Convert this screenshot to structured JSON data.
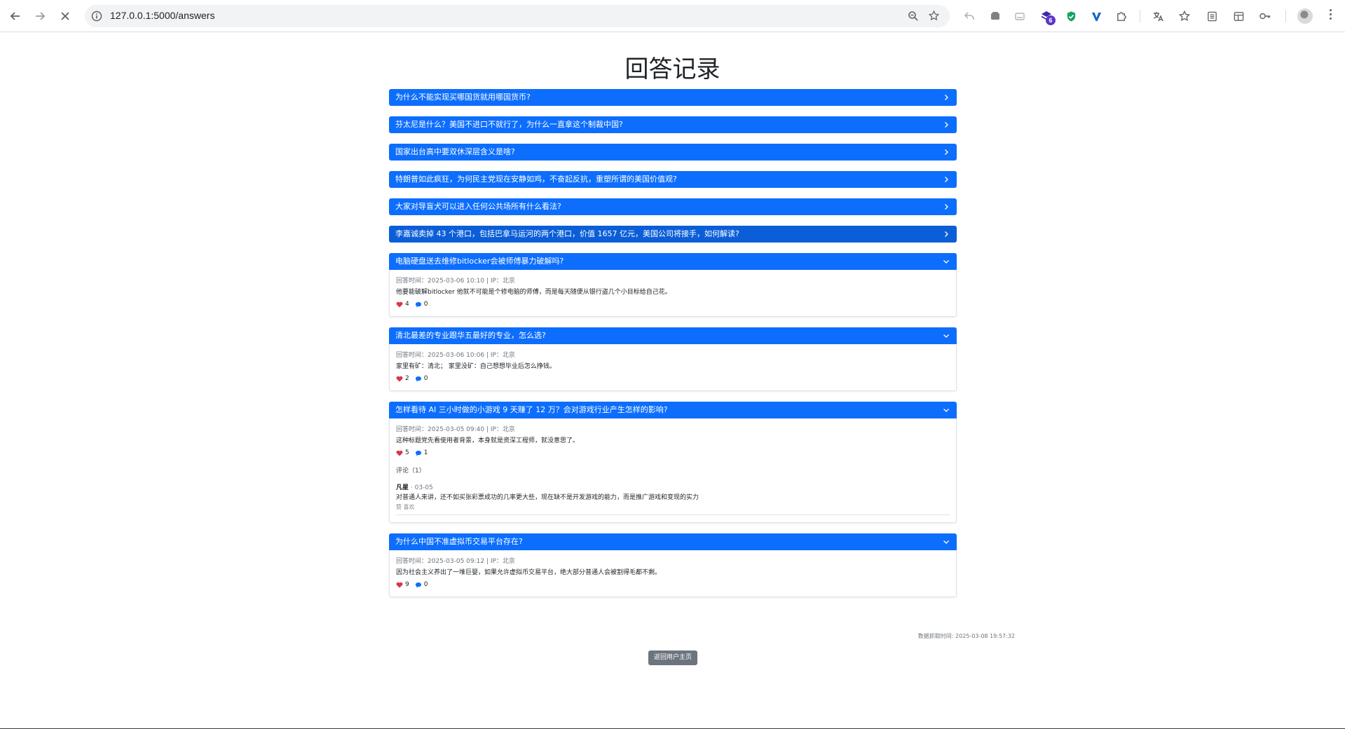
{
  "browser": {
    "url": "127.0.0.1:5000/answers",
    "extension_badge": "6"
  },
  "page": {
    "title": "回答记录",
    "fetch_time": "数据抓取时间: 2025-03-08 19:57:32",
    "back_button": "返回用户主页"
  },
  "questions": [
    {
      "title": "为什么不能实现买哪国货就用哪国货币?"
    },
    {
      "title": "芬太尼是什么？美国不进口不就行了，为什么一直拿这个制裁中国?"
    },
    {
      "title": "国家出台高中要双休深层含义是啥?"
    },
    {
      "title": "特朗普如此疯狂，为何民主党现在安静如鸡，不奋起反抗，重塑所谓的美国价值观?"
    },
    {
      "title": "大家对导盲犬可以进入任何公共场所有什么看法?"
    },
    {
      "title": "李嘉诚卖掉 43 个港口，包括巴拿马运河的两个港口，价值 1657 亿元，美国公司将接手，如何解读?"
    }
  ],
  "answers": [
    {
      "title": "电脑硬盘送去维修bitlocker会被师傅暴力破解吗?",
      "meta": "回答时间：2025-03-06 10:10 | IP：北京",
      "text": "他要能破解bitlocker 他就不可能是个修电脑的师傅，而是每天随便从银行盗几个小目标给自己花。",
      "likes": "4",
      "comments": "0"
    },
    {
      "title": "清北最差的专业跟华五最好的专业，怎么选?",
      "meta": "回答时间：2025-03-06 10:06 | IP：北京",
      "text": "家里有矿：清北； 家里没矿：自己想想毕业后怎么挣钱。",
      "likes": "2",
      "comments": "0"
    },
    {
      "title": "怎样看待 AI 三小时做的小游戏 9 天赚了 12 万？会对游戏行业产生怎样的影响?",
      "meta": "回答时间：2025-03-05 09:40 | IP：北京",
      "text": "这种标题党先看使用者背景，本身就是资深工程师，就没意思了。",
      "likes": "5",
      "comments": "1",
      "comment_title": "评论（1）",
      "comment_user": "凡星",
      "comment_date": "· 03-05",
      "comment_text": "对普通人来讲，还不如买张彩票成功的几率更大些，现在缺不是开发游戏的能力，而是推广游戏和变现的实力",
      "comment_like": "赞 喜欢"
    },
    {
      "title": "为什么中国不准虚拟币交易平台存在?",
      "meta": "回答时间：2025-03-05 09:12 | IP：北京",
      "text": "因为社会主义养出了一堆巨婴，如果允许虚拟币交易平台，绝大部分普通人会被割得毛都不剩。",
      "likes": "9",
      "comments": "0"
    }
  ],
  "colors": {
    "primary": "#0d6efd",
    "primary_active": "#0b5ed7",
    "secondary": "#6c757d",
    "heart": "#dc3545",
    "bubble": "#0d6efd"
  }
}
